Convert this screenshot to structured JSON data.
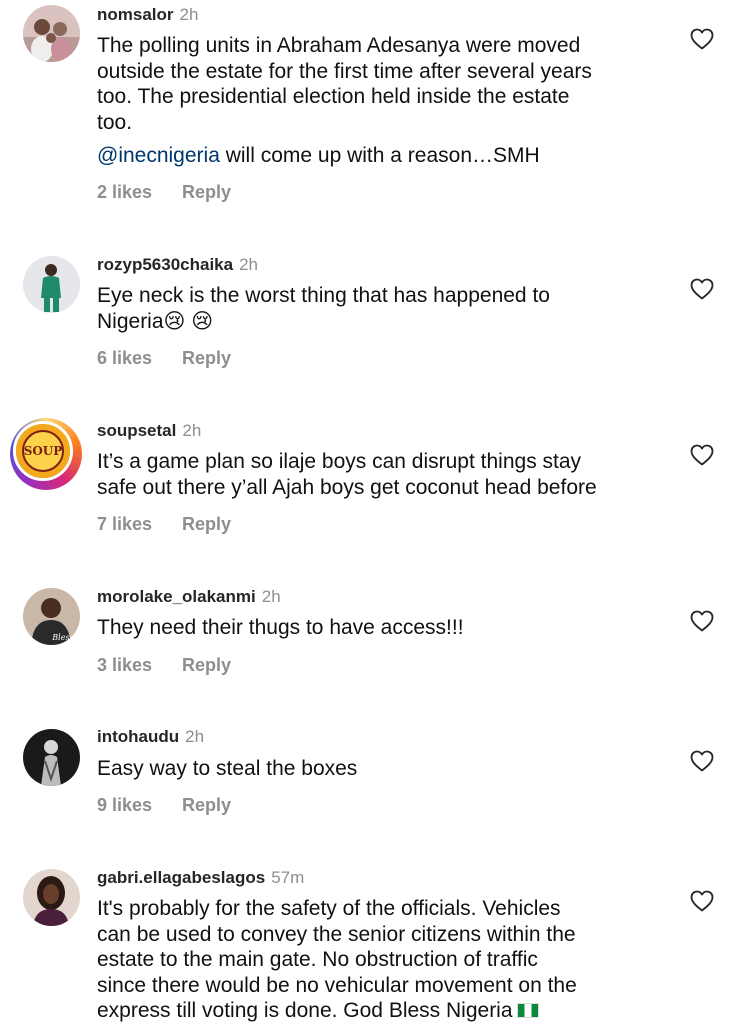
{
  "comments": [
    {
      "username": "nomsalor",
      "time": "2h",
      "text_lines": [
        "The polling units in Abraham Adesanya were moved",
        "outside the estate for the first time after several years",
        "too. The presidential election held inside the estate",
        "too."
      ],
      "mention": "@inecnigeria",
      "mention_rest": " will come up with a reason…SMH",
      "likes": "2 likes",
      "reply": "Reply",
      "avatar": "avatar-family"
    },
    {
      "username": "rozyp5630chaika",
      "time": "2h",
      "text_lines": [
        "Eye neck is the worst thing that has happened to",
        "Nigeria😢 😢"
      ],
      "likes": "6 likes",
      "reply": "Reply",
      "avatar": "avatar-person-green"
    },
    {
      "username": "soupsetal",
      "time": "2h",
      "text_lines": [
        "It’s a game plan so ilaje boys can disrupt things stay",
        "safe out there y’all Ajah boys get coconut head before"
      ],
      "likes": "7 likes",
      "reply": "Reply",
      "avatar": "avatar-soup-logo",
      "avatar_text": "SOUP"
    },
    {
      "username": "morolake_olakanmi",
      "time": "2h",
      "text_lines": [
        "They need their thugs to have access!!!"
      ],
      "likes": "3 likes",
      "reply": "Reply",
      "avatar": "avatar-woman-bless",
      "avatar_text": "Bless"
    },
    {
      "username": "intohaudu",
      "time": "2h",
      "text_lines": [
        "Easy way to steal the boxes"
      ],
      "likes": "9 likes",
      "reply": "Reply",
      "avatar": "avatar-person-dark"
    },
    {
      "username": "gabri.ellagabeslagos",
      "time": "57m",
      "text_lines": [
        "It's probably for the safety of the officials. Vehicles",
        "can be used to convey the senior citizens within the",
        "estate to the main gate. No obstruction of traffic",
        "since there would be no vehicular movement on the",
        "express till voting is done. God Bless Nigeria"
      ],
      "flag": "nigeria-flag",
      "avatar": "avatar-woman-portrait"
    }
  ],
  "colors": {
    "text": "#262626",
    "muted": "#8e8e8e",
    "mention": "#00376b"
  }
}
